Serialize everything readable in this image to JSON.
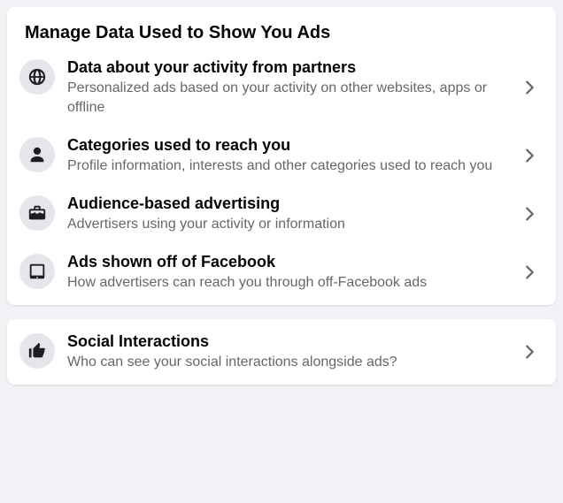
{
  "section1": {
    "header": "Manage Data Used to Show You Ads",
    "items": [
      {
        "icon": "globe-icon",
        "title": "Data about your activity from partners",
        "subtitle": "Personalized ads based on your activity on other websites, apps or offline"
      },
      {
        "icon": "user-icon",
        "title": "Categories used to reach you",
        "subtitle": "Profile information, interests and other categories used to reach you"
      },
      {
        "icon": "briefcase-icon",
        "title": "Audience-based advertising",
        "subtitle": "Advertisers using your activity or information"
      },
      {
        "icon": "tablet-icon",
        "title": "Ads shown off of Facebook",
        "subtitle": "How advertisers can reach you through off-Facebook ads"
      }
    ]
  },
  "section2": {
    "items": [
      {
        "icon": "thumbs-up-icon",
        "title": "Social Interactions",
        "subtitle": "Who can see your social interactions alongside ads?"
      }
    ]
  }
}
